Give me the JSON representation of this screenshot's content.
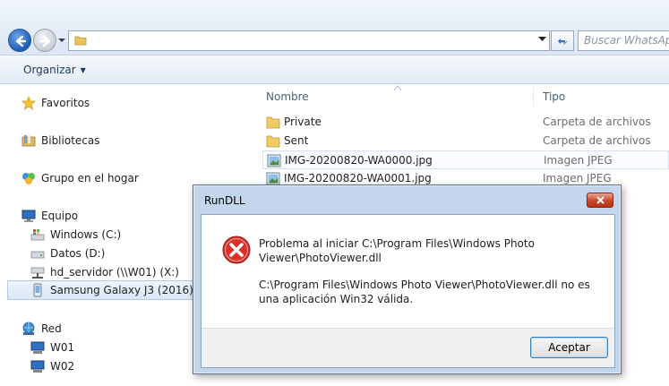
{
  "search": {
    "placeholder": "Buscar WhatsApp"
  },
  "toolbar": {
    "organize_label": "Organizar"
  },
  "sidebar": {
    "items": [
      {
        "label": "Favoritos",
        "icon": "star-icon"
      },
      {
        "label": "Bibliotecas",
        "icon": "library-icon"
      },
      {
        "label": "Grupo en el hogar",
        "icon": "homegroup-icon"
      },
      {
        "label": "Equipo",
        "icon": "computer-icon"
      },
      {
        "label": "Windows (C:)",
        "icon": "drive-icon"
      },
      {
        "label": "Datos (D:)",
        "icon": "drive-icon"
      },
      {
        "label": "hd_servidor (\\\\W01) (X:)",
        "icon": "network-drive-icon"
      },
      {
        "label": "Samsung Galaxy J3 (2016)",
        "icon": "phone-icon"
      },
      {
        "label": "Red",
        "icon": "network-icon"
      },
      {
        "label": "W01",
        "icon": "computer-icon"
      },
      {
        "label": "W02",
        "icon": "computer-icon"
      }
    ]
  },
  "filelist": {
    "columns": {
      "name": "Nombre",
      "type": "Tipo"
    },
    "rows": [
      {
        "name": "Private",
        "type": "Carpeta de archivos",
        "icon": "folder-icon"
      },
      {
        "name": "Sent",
        "type": "Carpeta de archivos",
        "icon": "folder-icon"
      },
      {
        "name": "IMG-20200820-WA0000.jpg",
        "type": "Imagen JPEG",
        "icon": "image-icon"
      },
      {
        "name": "IMG-20200820-WA0001.jpg",
        "type": "Imagen JPEG",
        "icon": "image-icon"
      }
    ]
  },
  "dialog": {
    "title": "RunDLL",
    "message1": "Problema al iniciar C:\\Program Files\\Windows Photo Viewer\\PhotoViewer.dll",
    "message2": "C:\\Program Files\\Windows Photo Viewer\\PhotoViewer.dll no es una aplicación Win32 válida.",
    "ok_label": "Aceptar"
  },
  "colors": {
    "error_red": "#d8322b",
    "close_red": "#c9462b",
    "accent_blue": "#1d5cb7"
  }
}
